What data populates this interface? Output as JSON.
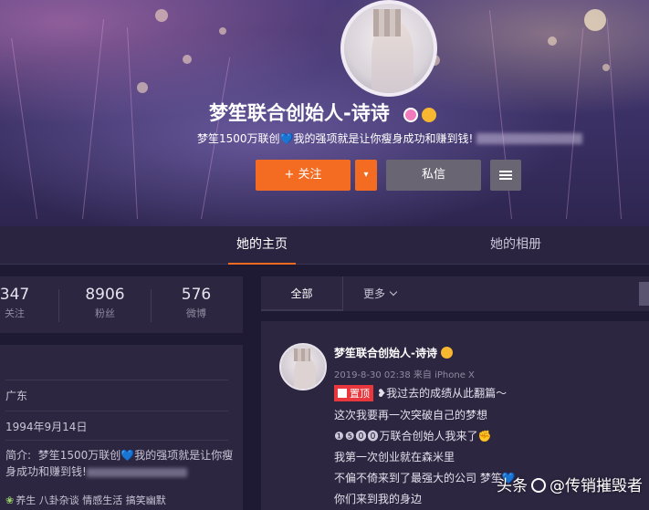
{
  "profile": {
    "name": "梦笙联合创始人-诗诗",
    "bio_prefix": "梦笙1500万联创",
    "bio_heart": "💙",
    "bio_suffix": "我的强项就是让你瘦身成功和赚到钱!",
    "follow_label": "+ 关注",
    "follow_more": "▾",
    "message_label": "私信"
  },
  "tabs": {
    "home": "她的主页",
    "album": "她的相册"
  },
  "stats": [
    {
      "value": "347",
      "label": "关注"
    },
    {
      "value": "8906",
      "label": "粉丝"
    },
    {
      "value": "576",
      "label": "微博"
    }
  ],
  "info": {
    "location": "广东",
    "birthday": "1994年9月14日",
    "bio_label": "简介:",
    "bio_prefix": "梦笙1500万联创",
    "bio_heart": "💙",
    "bio_suffix": "我的强项就是让你瘦身成功和赚到钱!",
    "tag_green": "❀",
    "tags": "养生 八卦杂谈 情感生活 搞笑幽默"
  },
  "feed": {
    "tab_all": "全部",
    "tab_more": "更多"
  },
  "post": {
    "author": "梦笙联合创始人-诗诗",
    "meta": "2019-8-30 02:38 来自 iPhone X",
    "pin_label": "置顶",
    "lines": [
      "我过去的成绩从此翻篇～",
      "这次我要再一次突破自己的梦想",
      "万联合创始人我来了",
      "我第一次创业就在森米里",
      "不偏不倚来到了最强大的公司 梦笙",
      "你们来到我的身边"
    ],
    "line1_prefix": "❥",
    "line3_prefix": "❶❺⓿⓿",
    "line3_suffix": "✊"
  },
  "watermark": {
    "left": "头条",
    "right": "@传销摧毁者"
  }
}
